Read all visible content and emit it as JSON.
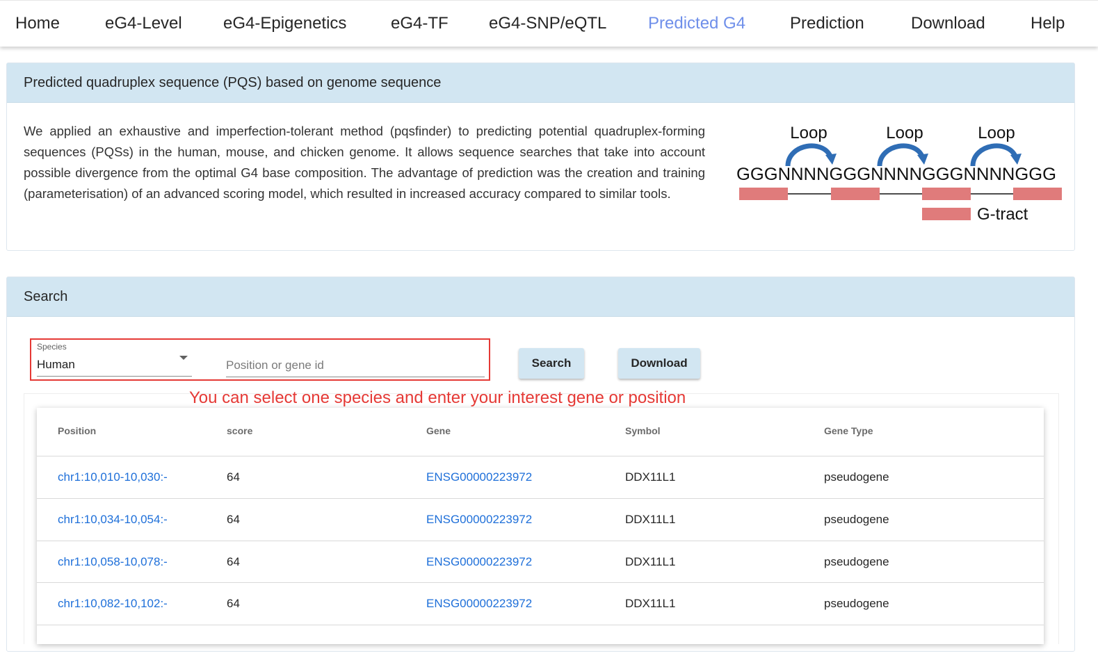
{
  "nav": {
    "items": [
      {
        "label": "Home"
      },
      {
        "label": "eG4-Level"
      },
      {
        "label": "eG4-Epigenetics"
      },
      {
        "label": "eG4-TF"
      },
      {
        "label": "eG4-SNP/eQTL"
      },
      {
        "label": "Predicted G4",
        "active": true
      },
      {
        "label": "Prediction"
      },
      {
        "label": "Download"
      },
      {
        "label": "Help"
      }
    ],
    "active_color": "#6f8fea"
  },
  "intro": {
    "header": "Predicted quadruplex sequence (PQS) based on genome sequence",
    "text": "We applied an exhaustive and imperfection-tolerant method (pqsfinder) to predicting potential quadruplex-forming sequences (PQSs) in the human, mouse, and chicken genome. It allows sequence searches that take into account possible divergence from the optimal G4 base composition. The advantage of prediction was the creation and training (parameterisation) of an advanced scoring model, which resulted in increased accuracy compared to similar tools.",
    "diagram": {
      "loop_label": "Loop",
      "sequence": "GGGNNNNGGGNNNNGGGNNNNGGG",
      "legend_label": "G-tract",
      "tract_color": "#e07b7b",
      "arrow_color": "#2f6db5"
    }
  },
  "search": {
    "header": "Search",
    "species_label": "Species",
    "species_value": "Human",
    "input_placeholder": "Position or gene id",
    "search_button": "Search",
    "download_button": "Download",
    "annotation": "You can select one species and enter your interest gene or position",
    "annotation_color": "#e53935"
  },
  "table": {
    "headers": {
      "position": "Position",
      "score": "score",
      "gene": "Gene",
      "symbol": "Symbol",
      "gene_type": "Gene Type"
    },
    "rows": [
      {
        "position": "chr1:10,010-10,030:-",
        "score": "64",
        "gene": "ENSG00000223972",
        "symbol": "DDX11L1",
        "gene_type": "pseudogene"
      },
      {
        "position": "chr1:10,034-10,054:-",
        "score": "64",
        "gene": "ENSG00000223972",
        "symbol": "DDX11L1",
        "gene_type": "pseudogene"
      },
      {
        "position": "chr1:10,058-10,078:-",
        "score": "64",
        "gene": "ENSG00000223972",
        "symbol": "DDX11L1",
        "gene_type": "pseudogene"
      },
      {
        "position": "chr1:10,082-10,102:-",
        "score": "64",
        "gene": "ENSG00000223972",
        "symbol": "DDX11L1",
        "gene_type": "pseudogene"
      }
    ],
    "link_color": "#1e6fd9"
  }
}
